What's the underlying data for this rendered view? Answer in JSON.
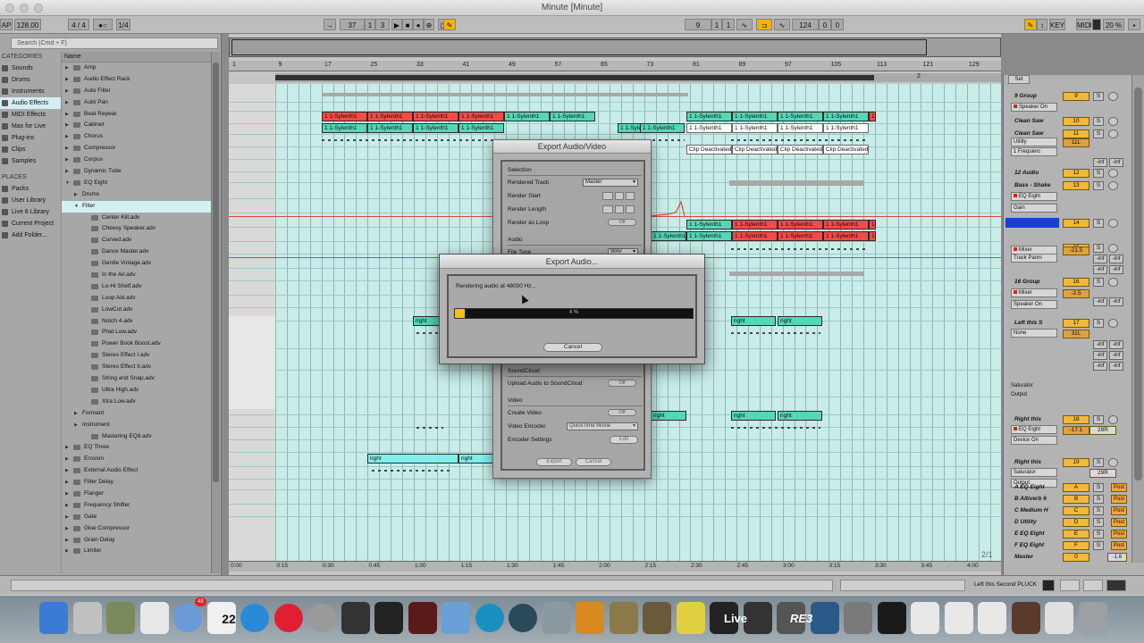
{
  "window": {
    "title": "Minute  [Minute]"
  },
  "controlbar": {
    "tap": "AP",
    "tempo": "128.00",
    "signature": "4 / 4",
    "metro": "1 Bar",
    "quantize": "1/4",
    "position": [
      "37",
      "1",
      "3"
    ],
    "loop_start": [
      "9",
      "1",
      "1"
    ],
    "loop_length": [
      "124",
      "0",
      "0"
    ],
    "key": "KEY",
    "midi": "MIDI",
    "cpu": "20 %"
  },
  "browser": {
    "search_placeholder": "Search (Cmd + F)",
    "categories_label": "CATEGORIES",
    "categories": [
      "Sounds",
      "Drums",
      "Instruments",
      "Audio Effects",
      "MIDI Effects",
      "Max for Live",
      "Plug-ins",
      "Clips",
      "Samples"
    ],
    "places_label": "PLACES",
    "places": [
      "Packs",
      "User Library",
      "Live 8 Library",
      "Current Project",
      "Add Folder..."
    ],
    "name_header": "Name",
    "tree": [
      {
        "label": "Amp",
        "indent": 0,
        "folder": true
      },
      {
        "label": "Audio Effect Rack",
        "indent": 0,
        "folder": true
      },
      {
        "label": "Auto Filter",
        "indent": 0,
        "folder": true
      },
      {
        "label": "Auto Pan",
        "indent": 0,
        "folder": true
      },
      {
        "label": "Beat Repeat",
        "indent": 0,
        "folder": true
      },
      {
        "label": "Cabinet",
        "indent": 0,
        "folder": true
      },
      {
        "label": "Chorus",
        "indent": 0,
        "folder": true
      },
      {
        "label": "Compressor",
        "indent": 0,
        "folder": true
      },
      {
        "label": "Corpus",
        "indent": 0,
        "folder": true
      },
      {
        "label": "Dynamic Tube",
        "indent": 0,
        "folder": true
      },
      {
        "label": "EQ Eight",
        "indent": 0,
        "folder": true,
        "open": true
      },
      {
        "label": "Drums",
        "indent": 1,
        "folder": false
      },
      {
        "label": "Filter",
        "indent": 1,
        "folder": false,
        "open": true,
        "selected": true
      },
      {
        "label": "Center Kill.adv",
        "indent": 2,
        "folder": true
      },
      {
        "label": "Cheesy Speaker.adv",
        "indent": 2,
        "folder": true
      },
      {
        "label": "Curved.adv",
        "indent": 2,
        "folder": true
      },
      {
        "label": "Dance Master.adv",
        "indent": 2,
        "folder": true
      },
      {
        "label": "Gentle Vintage.adv",
        "indent": 2,
        "folder": true
      },
      {
        "label": "In the Air.adv",
        "indent": 2,
        "folder": true
      },
      {
        "label": "Lo-Hi Shelf.adv",
        "indent": 2,
        "folder": true
      },
      {
        "label": "Loop Aid.adv",
        "indent": 2,
        "folder": true
      },
      {
        "label": "LowCut.adv",
        "indent": 2,
        "folder": true
      },
      {
        "label": "Notch 4.adv",
        "indent": 2,
        "folder": true
      },
      {
        "label": "Phat Low.adv",
        "indent": 2,
        "folder": true
      },
      {
        "label": "Power Book Boost.adv",
        "indent": 2,
        "folder": true
      },
      {
        "label": "Stereo Effect I.adv",
        "indent": 2,
        "folder": true
      },
      {
        "label": "Stereo Effect II.adv",
        "indent": 2,
        "folder": true
      },
      {
        "label": "String and Snap.adv",
        "indent": 2,
        "folder": true
      },
      {
        "label": "Ultra High.adv",
        "indent": 2,
        "folder": true
      },
      {
        "label": "Xtra Low.adv",
        "indent": 2,
        "folder": true
      },
      {
        "label": "Formant",
        "indent": 1,
        "folder": false
      },
      {
        "label": "Instrument",
        "indent": 1,
        "folder": false
      },
      {
        "label": "Mastering EQ8.adv",
        "indent": 2,
        "folder": true
      },
      {
        "label": "EQ Three",
        "indent": 0,
        "folder": true
      },
      {
        "label": "Erosion",
        "indent": 0,
        "folder": true
      },
      {
        "label": "External Audio Effect",
        "indent": 0,
        "folder": true
      },
      {
        "label": "Filter Delay",
        "indent": 0,
        "folder": true
      },
      {
        "label": "Flanger",
        "indent": 0,
        "folder": true
      },
      {
        "label": "Frequency Shifter",
        "indent": 0,
        "folder": true
      },
      {
        "label": "Gate",
        "indent": 0,
        "folder": true
      },
      {
        "label": "Glue Compressor",
        "indent": 0,
        "folder": true
      },
      {
        "label": "Grain Delay",
        "indent": 0,
        "folder": true
      },
      {
        "label": "Limiter",
        "indent": 0,
        "folder": true
      }
    ]
  },
  "arrangement": {
    "bar_numbers": [
      "1",
      "9",
      "17",
      "25",
      "33",
      "41",
      "49",
      "57",
      "65",
      "73",
      "81",
      "89",
      "97",
      "105",
      "113",
      "121",
      "129"
    ],
    "time_labels": [
      "0:00",
      "0:15",
      "0:30",
      "0:45",
      "1:00",
      "1:15",
      "1:30",
      "1:45",
      "2:00",
      "2:15",
      "2:30",
      "2:45",
      "3:00",
      "3:15",
      "3:30",
      "3:45",
      "4:00"
    ],
    "loop_marker": "2",
    "page": "2/1",
    "clip_label_sylenth": "1 1-Sylenth1",
    "clip_label_deactivated": "Clip Deactivated",
    "clip_label_right": "right"
  },
  "mixer": {
    "tracks": [
      {
        "name": "9 Group",
        "num": "9",
        "device": "Speaker On"
      },
      {
        "name": "Clean Saw",
        "num": "10"
      },
      {
        "name": "Clean Saw",
        "num": "11",
        "device": "Utility",
        "vol": "11L"
      },
      {
        "name": "12 Audio",
        "num": "12"
      },
      {
        "name": "Bass - Shake",
        "num": "13",
        "device": "EQ Eight"
      },
      {
        "name": "",
        "num": "14",
        "selected": true
      },
      {
        "name": "",
        "num": "15",
        "device": "Mixer",
        "vol": "-21.5"
      },
      {
        "name": "16 Group",
        "num": "16",
        "device": "Mixer",
        "vol": "-2.5"
      },
      {
        "name": "Left this S",
        "num": "17",
        "device": "None",
        "vol": "31L"
      },
      {
        "name": "Right this",
        "num": "18",
        "device": "EQ Eight",
        "vol": "-17.1",
        "pan": "29R"
      },
      {
        "name": "Right this",
        "num": "19",
        "device": "Saturator",
        "pan": "29R"
      }
    ],
    "returns": [
      {
        "name": "A EQ Eight",
        "letter": "A"
      },
      {
        "name": "B Altiverb 6",
        "letter": "B"
      },
      {
        "name": "C Medium H",
        "letter": "C"
      },
      {
        "name": "D Utility",
        "letter": "D"
      },
      {
        "name": "E EQ Eight",
        "letter": "E"
      },
      {
        "name": "F EQ Eight",
        "letter": "F"
      }
    ],
    "master": {
      "name": "Master",
      "num": "0",
      "vol": "-1.6"
    },
    "post_label": "Post",
    "set_label": "Set",
    "inf": "-inf",
    "sat_labels": [
      "Saturator",
      "Output"
    ],
    "extra_devices": [
      "1 Frequenc",
      "Gain",
      "Track Panni",
      "Speaker On",
      "Device On",
      "Output"
    ]
  },
  "export_dialog": {
    "title": "Export Audio/Video",
    "selection": "Selection",
    "rendered_track_label": "Rendered Track",
    "rendered_track_value": "Master",
    "render_start": "Render Start",
    "render_length": "Render Length",
    "render_loop": "Render as Loop",
    "audio": "Audio",
    "file_type_label": "File Type",
    "file_type_value": "WAV",
    "soundcloud": "SoundCloud",
    "upload_label": "Upload Audio to SoundCloud",
    "video": "Video",
    "create_video": "Create Video",
    "video_encoder_label": "Video Encoder",
    "video_encoder_value": "QuickTime Movie",
    "encoder_settings": "Encoder Settings",
    "edit": "Edit",
    "off": "Off",
    "export_btn": "Export",
    "cancel_btn": "Cancel"
  },
  "render_dialog": {
    "title": "Export Audio...",
    "message": "Rendering audio at 48000 Hz...",
    "progress": 4,
    "progress_text": "4 %",
    "cancel": "Cancel"
  },
  "status": {
    "message": "Left this Second PLUCK"
  },
  "dock": {
    "calendar_day": "22",
    "mail_badge": "48",
    "live_label": "Live",
    "re3_label": "RE3"
  },
  "colors": {
    "lane": "#c9ece9",
    "clip_red": "#f24b48",
    "clip_teal": "#55d7b6",
    "accent_orange": "#f2b83a",
    "progress_fill": "#f2c200"
  }
}
